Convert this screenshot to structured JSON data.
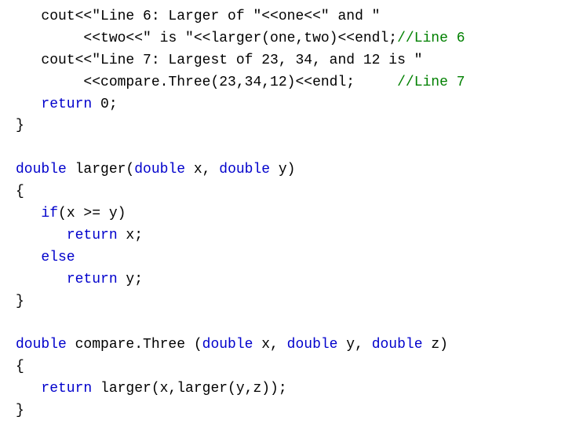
{
  "lines": [
    {
      "indent": "   ",
      "segments": [
        {
          "t": "cout<<\"Line 6: Larger of \"<<one<<\" and \"",
          "c": "tx"
        }
      ]
    },
    {
      "indent": "        ",
      "segments": [
        {
          "t": "<<two<<\" is \"<<larger(one,two)<<endl;",
          "c": "tx"
        },
        {
          "t": "//Line 6",
          "c": "cm"
        }
      ]
    },
    {
      "indent": "   ",
      "segments": [
        {
          "t": "cout<<\"Line 7: Largest of 23, 34, and 12 is \"",
          "c": "tx"
        }
      ]
    },
    {
      "indent": "        ",
      "segments": [
        {
          "t": "<<compare.Three(23,34,12)<<endl;     ",
          "c": "tx"
        },
        {
          "t": "//Line 7",
          "c": "cm"
        }
      ]
    },
    {
      "indent": "   ",
      "segments": [
        {
          "t": "return",
          "c": "kw"
        },
        {
          "t": " 0;",
          "c": "tx"
        }
      ]
    },
    {
      "indent": "",
      "segments": [
        {
          "t": "}",
          "c": "tx"
        }
      ]
    },
    {
      "indent": "",
      "segments": [
        {
          "t": " ",
          "c": "tx"
        }
      ]
    },
    {
      "indent": "",
      "segments": [
        {
          "t": "double",
          "c": "kw"
        },
        {
          "t": " larger(",
          "c": "tx"
        },
        {
          "t": "double",
          "c": "kw"
        },
        {
          "t": " x, ",
          "c": "tx"
        },
        {
          "t": "double",
          "c": "kw"
        },
        {
          "t": " y)",
          "c": "tx"
        }
      ]
    },
    {
      "indent": "",
      "segments": [
        {
          "t": "{",
          "c": "tx"
        }
      ]
    },
    {
      "indent": "   ",
      "segments": [
        {
          "t": "if",
          "c": "kw"
        },
        {
          "t": "(x >= y)",
          "c": "tx"
        }
      ]
    },
    {
      "indent": "      ",
      "segments": [
        {
          "t": "return",
          "c": "kw"
        },
        {
          "t": " x;",
          "c": "tx"
        }
      ]
    },
    {
      "indent": "   ",
      "segments": [
        {
          "t": "else",
          "c": "kw"
        }
      ]
    },
    {
      "indent": "      ",
      "segments": [
        {
          "t": "return",
          "c": "kw"
        },
        {
          "t": " y;",
          "c": "tx"
        }
      ]
    },
    {
      "indent": "",
      "segments": [
        {
          "t": "}",
          "c": "tx"
        }
      ]
    },
    {
      "indent": "",
      "segments": [
        {
          "t": " ",
          "c": "tx"
        }
      ]
    },
    {
      "indent": "",
      "segments": [
        {
          "t": "double",
          "c": "kw"
        },
        {
          "t": " compare.Three (",
          "c": "tx"
        },
        {
          "t": "double",
          "c": "kw"
        },
        {
          "t": " x, ",
          "c": "tx"
        },
        {
          "t": "double",
          "c": "kw"
        },
        {
          "t": " y, ",
          "c": "tx"
        },
        {
          "t": "double",
          "c": "kw"
        },
        {
          "t": " z)",
          "c": "tx"
        }
      ]
    },
    {
      "indent": "",
      "segments": [
        {
          "t": "{",
          "c": "tx"
        }
      ]
    },
    {
      "indent": "   ",
      "segments": [
        {
          "t": "return",
          "c": "kw"
        },
        {
          "t": " larger(x,larger(y,z));",
          "c": "tx"
        }
      ]
    },
    {
      "indent": "",
      "segments": [
        {
          "t": "}",
          "c": "tx"
        }
      ]
    }
  ]
}
